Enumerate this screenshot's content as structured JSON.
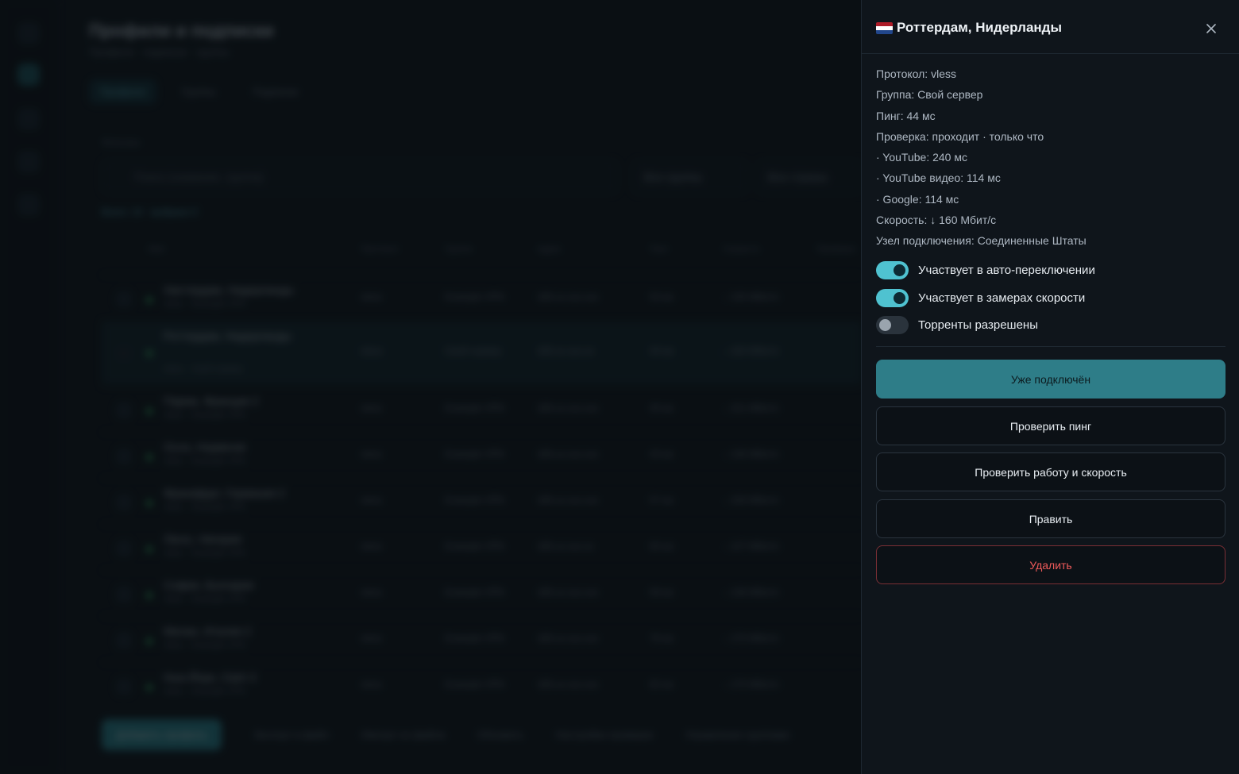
{
  "background": {
    "title": "Профили и подписки",
    "subtitle": "Профили · подписки · группы",
    "tabs": [
      "Профили",
      "Группы",
      "Подписки"
    ],
    "section_label": "Фильтры",
    "search_placeholder": "Поиск (название, группа)",
    "group_filter": "Все группы",
    "country_filter": "Все страны",
    "count_text": "Всего: 10 · выбрано 0",
    "columns": [
      "Имя",
      "Протокол",
      "Группа",
      "Адрес",
      "Пинг",
      "Скорость",
      "Проверка"
    ],
    "rows": [
      {
        "name": "Амстердам, Нидерланды",
        "sub": "vless · Example VPN",
        "protocol": "vless",
        "group": "Example VPN",
        "address": "185.xx.xxx.xxx",
        "ping": "53 мс",
        "speed": "↓ 135 Мбит/с"
      },
      {
        "name": "Роттердам, Нидерланды",
        "sub": "vless · Свой сервер",
        "protocol": "vless",
        "group": "Свой сервер",
        "address": "185.xx.xxx.xx",
        "ping": "44 мс",
        "speed": "↓ 160 Мбит/с"
      },
      {
        "name": "Париж, Франция 2",
        "sub": "vless · Example VPN",
        "protocol": "vless",
        "group": "Example VPN",
        "address": "185.xx.xxx.xxx",
        "ping": "45 мс",
        "speed": "↓ 151 Мбит/с"
      },
      {
        "name": "Осло, Норвегия",
        "sub": "vless · Example VPN",
        "protocol": "vless",
        "group": "Example VPN",
        "address": "185.xx.xxx.xxx",
        "ping": "43 мс",
        "speed": "↓ 136 Мбит/с"
      },
      {
        "name": "Франкфурт, Германия 2",
        "sub": "vless · Example VPN",
        "protocol": "vless",
        "group": "Example VPN",
        "address": "185.xx.xxx.xxx",
        "ping": "57 мс",
        "speed": "↓ 159 Мбит/с"
      },
      {
        "name": "Лагос, Нигерия",
        "sub": "vless · Example VPN",
        "protocol": "vless",
        "group": "Example VPN",
        "address": "185.xx.xxx.xx",
        "ping": "60 мс",
        "speed": "↓ 127 Мбит/с"
      },
      {
        "name": "София, Болгария",
        "sub": "vless · Example VPN",
        "protocol": "vless",
        "group": "Example VPN",
        "address": "185.xx.xxx.xxx",
        "ping": "59 мс",
        "speed": "↓ 138 Мбит/с"
      },
      {
        "name": "Милан, Италия 2",
        "sub": "vless · Example VPN",
        "protocol": "vless",
        "group": "Example VPN",
        "address": "185.xx.xxx.xxx",
        "ping": "76 мс",
        "speed": "↓ 170 Мбит/с"
      },
      {
        "name": "Нью-Йорк, США 3",
        "sub": "vless · Example VPN",
        "protocol": "vless",
        "group": "Example VPN",
        "address": "185.xx.xxx.xxx",
        "ping": "82 мс",
        "speed": "↓ 170 Мбит/с"
      }
    ],
    "footer": [
      "Добавить профиль",
      "Экспорт в файл",
      "Импорт из файла",
      "Обновить",
      "Настройки проверки",
      "Управление группами"
    ]
  },
  "panel": {
    "flag_colors": [
      "#AE1C28",
      "#FFFFFF",
      "#21468B"
    ],
    "title": "Роттердам, Нидерланды",
    "close_icon": "close-icon",
    "info": [
      "Протокол: vless",
      "Группа: Свой сервер",
      "Пинг: 44 мс",
      "Проверка: проходит · только что",
      "· YouTube: 240 мс",
      "· YouTube видео: 114 мс",
      "· Google: 114 мс",
      "Скорость: ↓ 160 Мбит/с",
      "Узел подключения: Соединенные Штаты"
    ],
    "toggles": [
      {
        "label": "Участвует в авто-переключении",
        "on": true
      },
      {
        "label": "Участвует в замерах скорости",
        "on": true
      },
      {
        "label": "Торренты разрешены",
        "on": false
      }
    ],
    "buttons": {
      "connected": "Уже подключён",
      "check_ping": "Проверить пинг",
      "check_speed": "Проверить работу и скорость",
      "edit": "Править",
      "delete": "Удалить"
    }
  }
}
